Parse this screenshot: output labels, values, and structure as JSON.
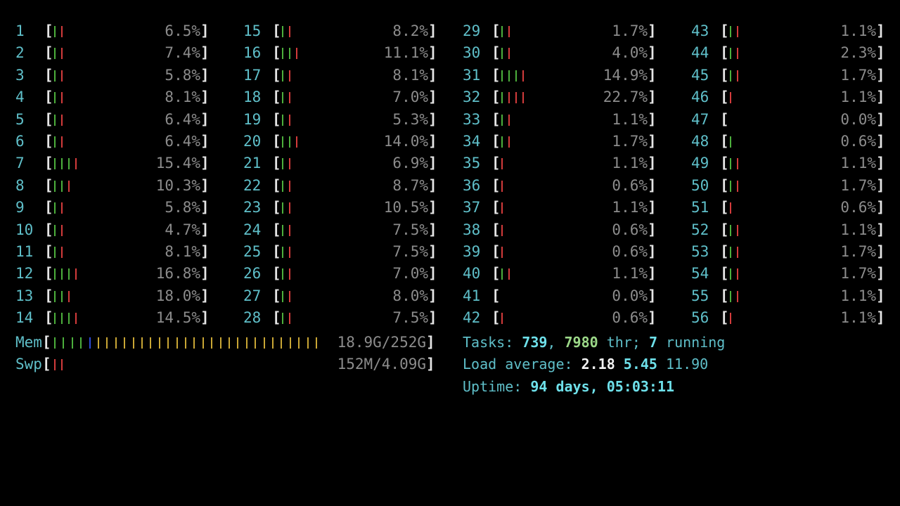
{
  "colors": {
    "green": "#4caf3c",
    "red": "#d33b3b",
    "blue": "#2c49d8",
    "yellow": "#c9a635"
  },
  "cpus": [
    {
      "id": "1",
      "pct": "6.5%",
      "bars": "gr"
    },
    {
      "id": "2",
      "pct": "7.4%",
      "bars": "gr"
    },
    {
      "id": "3",
      "pct": "5.8%",
      "bars": "gr"
    },
    {
      "id": "4",
      "pct": "8.1%",
      "bars": "gr"
    },
    {
      "id": "5",
      "pct": "6.4%",
      "bars": "gr"
    },
    {
      "id": "6",
      "pct": "6.4%",
      "bars": "gr"
    },
    {
      "id": "7",
      "pct": "15.4%",
      "bars": "gggr"
    },
    {
      "id": "8",
      "pct": "10.3%",
      "bars": "ggr"
    },
    {
      "id": "9",
      "pct": "5.8%",
      "bars": "gr"
    },
    {
      "id": "10",
      "pct": "4.7%",
      "bars": "gr"
    },
    {
      "id": "11",
      "pct": "8.1%",
      "bars": "gr"
    },
    {
      "id": "12",
      "pct": "16.8%",
      "bars": "gggr"
    },
    {
      "id": "13",
      "pct": "18.0%",
      "bars": "ggr"
    },
    {
      "id": "14",
      "pct": "14.5%",
      "bars": "gggr"
    },
    {
      "id": "15",
      "pct": "8.2%",
      "bars": "gr"
    },
    {
      "id": "16",
      "pct": "11.1%",
      "bars": "ggr"
    },
    {
      "id": "17",
      "pct": "8.1%",
      "bars": "gr"
    },
    {
      "id": "18",
      "pct": "7.0%",
      "bars": "gr"
    },
    {
      "id": "19",
      "pct": "5.3%",
      "bars": "gr"
    },
    {
      "id": "20",
      "pct": "14.0%",
      "bars": "ggr"
    },
    {
      "id": "21",
      "pct": "6.9%",
      "bars": "gr"
    },
    {
      "id": "22",
      "pct": "8.7%",
      "bars": "gr"
    },
    {
      "id": "23",
      "pct": "10.5%",
      "bars": "gr"
    },
    {
      "id": "24",
      "pct": "7.5%",
      "bars": "gr"
    },
    {
      "id": "25",
      "pct": "7.5%",
      "bars": "gr"
    },
    {
      "id": "26",
      "pct": "7.0%",
      "bars": "gr"
    },
    {
      "id": "27",
      "pct": "8.0%",
      "bars": "gr"
    },
    {
      "id": "28",
      "pct": "7.5%",
      "bars": "gr"
    },
    {
      "id": "29",
      "pct": "1.7%",
      "bars": "gr"
    },
    {
      "id": "30",
      "pct": "4.0%",
      "bars": "gr"
    },
    {
      "id": "31",
      "pct": "14.9%",
      "bars": "gggr"
    },
    {
      "id": "32",
      "pct": "22.7%",
      "bars": "grrr"
    },
    {
      "id": "33",
      "pct": "1.1%",
      "bars": "gr"
    },
    {
      "id": "34",
      "pct": "1.7%",
      "bars": "gr"
    },
    {
      "id": "35",
      "pct": "1.1%",
      "bars": "r"
    },
    {
      "id": "36",
      "pct": "0.6%",
      "bars": "r"
    },
    {
      "id": "37",
      "pct": "1.1%",
      "bars": "r"
    },
    {
      "id": "38",
      "pct": "0.6%",
      "bars": "r"
    },
    {
      "id": "39",
      "pct": "0.6%",
      "bars": "r"
    },
    {
      "id": "40",
      "pct": "1.1%",
      "bars": "gr"
    },
    {
      "id": "41",
      "pct": "0.0%",
      "bars": ""
    },
    {
      "id": "42",
      "pct": "0.6%",
      "bars": "r"
    },
    {
      "id": "43",
      "pct": "1.1%",
      "bars": "gr"
    },
    {
      "id": "44",
      "pct": "2.3%",
      "bars": "gr"
    },
    {
      "id": "45",
      "pct": "1.7%",
      "bars": "gr"
    },
    {
      "id": "46",
      "pct": "1.1%",
      "bars": "r"
    },
    {
      "id": "47",
      "pct": "0.0%",
      "bars": ""
    },
    {
      "id": "48",
      "pct": "0.6%",
      "bars": "g"
    },
    {
      "id": "49",
      "pct": "1.1%",
      "bars": "gr"
    },
    {
      "id": "50",
      "pct": "1.7%",
      "bars": "gr"
    },
    {
      "id": "51",
      "pct": "0.6%",
      "bars": "r"
    },
    {
      "id": "52",
      "pct": "1.1%",
      "bars": "gr"
    },
    {
      "id": "53",
      "pct": "1.7%",
      "bars": "gr"
    },
    {
      "id": "54",
      "pct": "1.7%",
      "bars": "gr"
    },
    {
      "id": "55",
      "pct": "1.1%",
      "bars": "gr"
    },
    {
      "id": "56",
      "pct": "1.1%",
      "bars": "r"
    }
  ],
  "mem": {
    "label": "Mem",
    "value": "18.9G/252G",
    "bars": "ggggbyyyyyyyyyyyyyyyyyyyyyyyyyy"
  },
  "swp": {
    "label": "Swp",
    "value": "152M/4.09G",
    "bars": "rr"
  },
  "tasks": {
    "label": "Tasks: ",
    "count": "739",
    "sep": ", ",
    "threads": "7980",
    "thr_label": " thr",
    "sep2": "; ",
    "running": "7",
    "running_label": " running"
  },
  "load": {
    "label": "Load average: ",
    "avg1": "2.18",
    "avg5": "5.45",
    "avg15": "11.90"
  },
  "uptime": {
    "label": "Uptime: ",
    "value": "94 days, 05:03:11"
  }
}
